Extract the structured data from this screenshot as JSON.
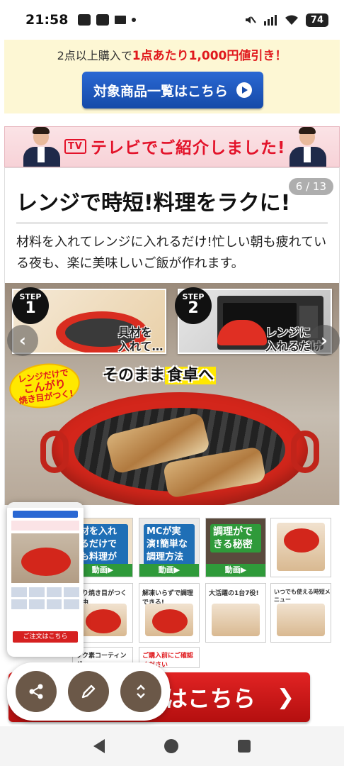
{
  "status_bar": {
    "time": "21:58",
    "battery": "74"
  },
  "promo": {
    "text_prefix": "2点以上購入で",
    "text_highlight": "1点あたり1,000円値引き！",
    "button_label": "対象商品一覧はこちら"
  },
  "tv_banner": {
    "tag": "TV",
    "title": "テレビでご紹介しました!"
  },
  "slide": {
    "counter": "6 / 13",
    "headline": "レンジで時短!料理をラクに!",
    "description": "材料を入れてレンジに入れるだけ!忙しい朝も疲れている夜も、楽に美味しいご飯が作れます。",
    "step1": {
      "word": "STEP",
      "num": "1",
      "caption_l1": "具材を",
      "caption_l2": "入れて…"
    },
    "step2": {
      "word": "STEP",
      "num": "2",
      "caption_l1": "レンジに",
      "caption_l2": "入れるだけ"
    },
    "serve_text_a": "そのまま",
    "serve_text_b": "食卓へ",
    "burst_l1": "レンジだけで",
    "burst_l2": "こんがり",
    "burst_l3": "焼き目がつく!"
  },
  "thumbnails": [
    {
      "title": "材を入れるだけでも料理ができる",
      "bar": "動画▶"
    },
    {
      "title": "MCが実演!簡単な調理方法",
      "bar": "動画▶"
    },
    {
      "title": "調理ができる秘密",
      "bar": "動画▶"
    },
    {
      "title": "",
      "bar": ""
    },
    {
      "title": "くり焼き目がつく理由",
      "bar": ""
    },
    {
      "title": "解凍いらずで調理できる!",
      "bar": ""
    },
    {
      "title": "大活躍の1台7役!",
      "bar": ""
    },
    {
      "title": "いつでも使える時短メニュー",
      "bar": ""
    },
    {
      "title": "ック素コーティング",
      "bar": ""
    },
    {
      "title": "ご購入前にご確認ください",
      "bar": ""
    }
  ],
  "preview": {
    "order_label": "ご注文はこちら"
  },
  "order_bar": {
    "label": "はこちら",
    "chevron": "❯"
  },
  "colors": {
    "accent_red": "#e0191d",
    "button_blue": "#154aa8",
    "promo_bg": "#fdf7d4",
    "fab_brown": "#6b5848"
  },
  "icons": [
    "share-icon",
    "pencil-icon",
    "expand-icon",
    "back-icon",
    "home-icon",
    "recents-icon"
  ]
}
